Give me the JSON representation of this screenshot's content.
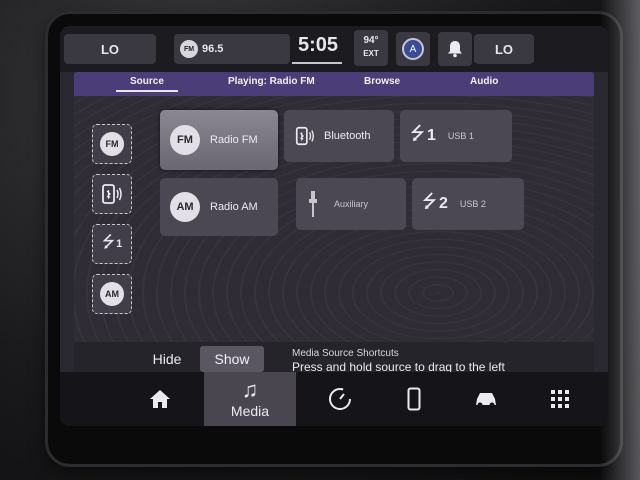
{
  "status": {
    "left_climate": "LO",
    "right_climate": "LO",
    "radio_badge": "FM",
    "radio_station": "96.5",
    "clock": "5:05",
    "temp_value": "94°",
    "temp_label": "EXT",
    "profile_initial": "A"
  },
  "tabs": [
    {
      "label": "Source",
      "active": true
    },
    {
      "label": "Playing: Radio FM"
    },
    {
      "label": "Browse"
    },
    {
      "label": "Audio"
    }
  ],
  "shortcuts": [
    {
      "icon": "fm-icon",
      "label": "FM"
    },
    {
      "icon": "bluetooth-phone-icon"
    },
    {
      "icon": "usb-icon",
      "label": "1"
    },
    {
      "icon": "am-icon",
      "label": "AM"
    }
  ],
  "sources": {
    "radio_fm": {
      "badge": "FM",
      "label": "Radio FM"
    },
    "bluetooth": {
      "label": "Bluetooth"
    },
    "usb1": {
      "num": "1",
      "label": "USB 1"
    },
    "radio_am": {
      "badge": "AM",
      "label": "Radio AM"
    },
    "auxiliary": {
      "label": "Auxiliary"
    },
    "usb2": {
      "num": "2",
      "label": "USB 2"
    }
  },
  "hint": {
    "hide_label": "Hide",
    "show_label": "Show",
    "title": "Media Source Shortcuts",
    "text": "Press and hold source to drag to the left"
  },
  "nav": {
    "media_label": "Media"
  }
}
